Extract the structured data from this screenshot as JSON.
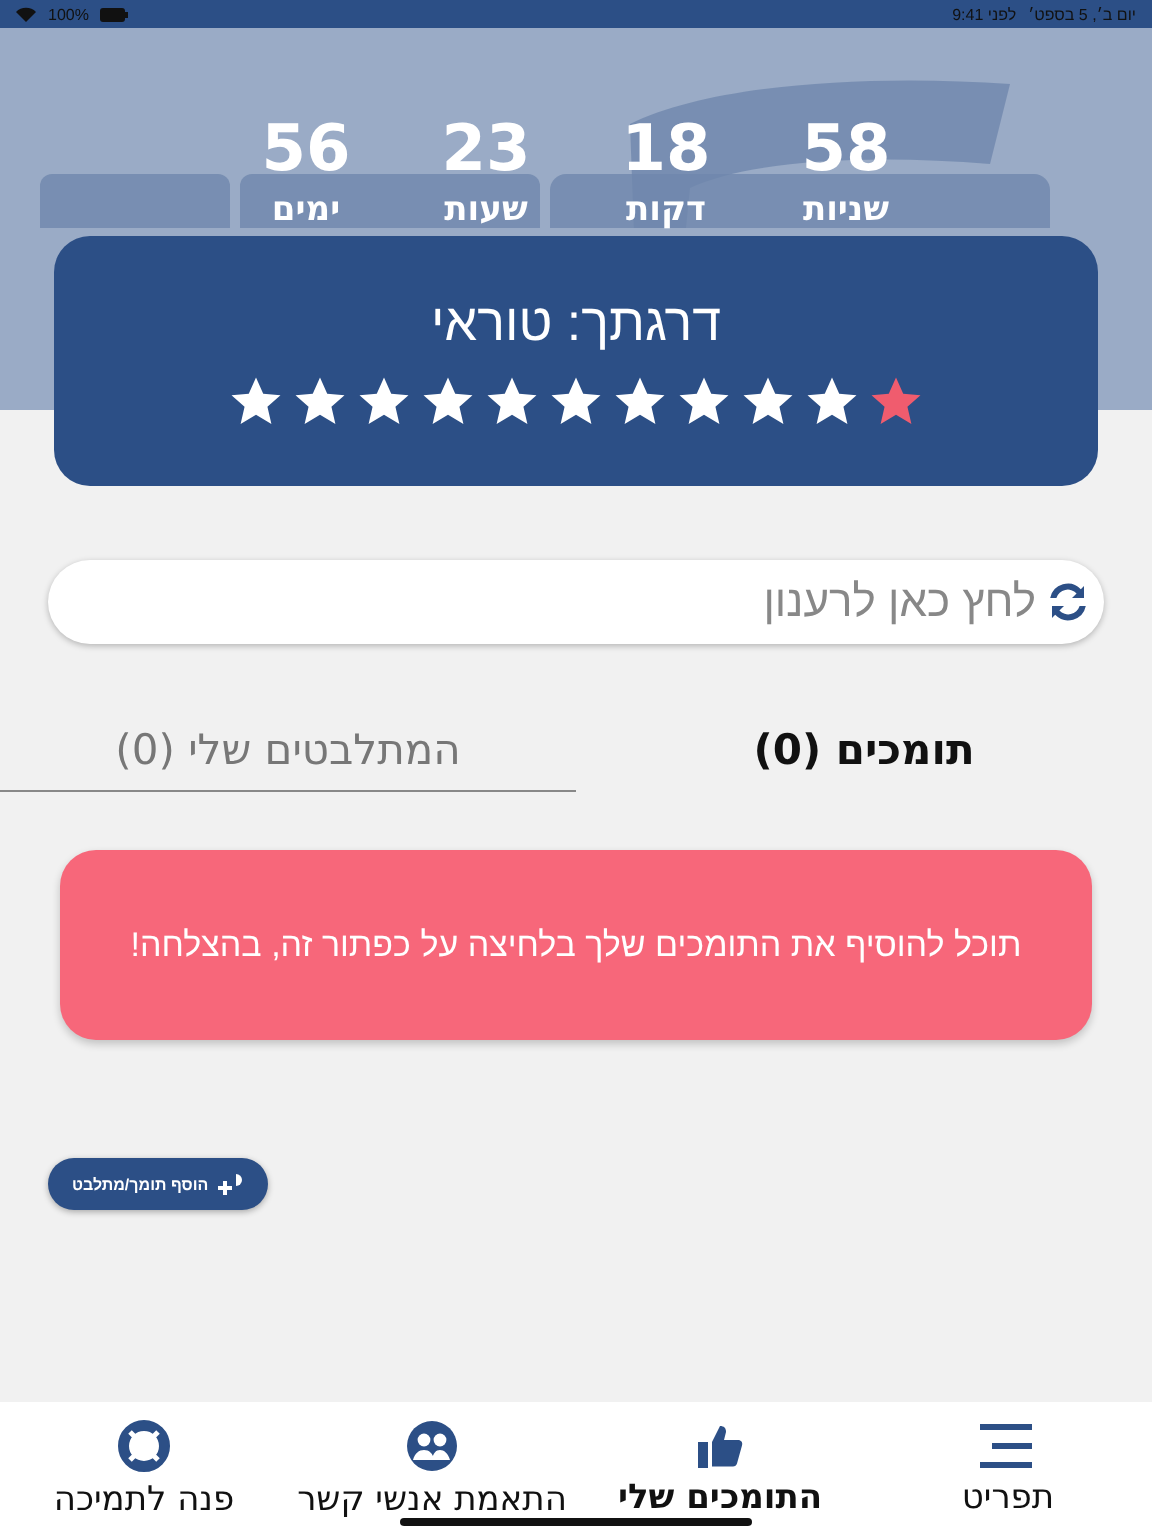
{
  "status_bar": {
    "battery": "100%",
    "time": "9:41 לפני",
    "date": "יום ב׳, 5 בספט׳"
  },
  "countdown": [
    {
      "value": "58",
      "unit": "שניות"
    },
    {
      "value": "18",
      "unit": "דקות"
    },
    {
      "value": "23",
      "unit": "שעות"
    },
    {
      "value": "56",
      "unit": "ימים"
    }
  ],
  "rank": {
    "title": "דרגתך: טוראי",
    "steps": [
      {
        "selected": true
      },
      {
        "selected": false
      },
      {
        "selected": false
      },
      {
        "selected": false
      },
      {
        "selected": false
      },
      {
        "selected": false
      },
      {
        "selected": false
      },
      {
        "selected": false
      },
      {
        "selected": false
      },
      {
        "selected": false
      },
      {
        "selected": false
      }
    ]
  },
  "refresh": {
    "placeholder": "לחץ כאן לרענון"
  },
  "tabs": [
    {
      "label": "תומכים (0)",
      "selected": true
    },
    {
      "label": "המתלבטים שלי (0)",
      "selected": false
    }
  ],
  "notice": "תוכל להוסיף את התומכים שלך בלחיצה על כפתור זה, בהצלחה!",
  "add_button": "הוסף תומך/מתלבט",
  "bottom_nav": [
    {
      "kind": "menu",
      "label": "תפריט",
      "selected": false
    },
    {
      "kind": "like",
      "label": "התומכים שלי",
      "selected": true
    },
    {
      "kind": "contacts",
      "label": "התאמת אנשי קשר",
      "selected": false
    },
    {
      "kind": "support",
      "label": "פנה לתמיכה",
      "selected": false
    }
  ]
}
